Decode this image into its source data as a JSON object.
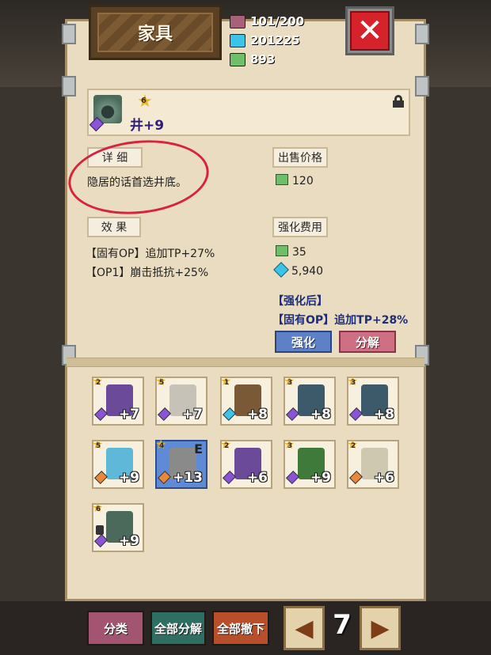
{
  "header": {
    "title": "家具",
    "resources": {
      "storage": "101/200",
      "crystal": "201225",
      "ore": "893"
    },
    "close_icon": "close-x-icon"
  },
  "item": {
    "name": "井+9",
    "star_level": "6",
    "locked": true
  },
  "detail": {
    "tab_label": "详 细",
    "description": "隐居的话首选井底。"
  },
  "sell": {
    "label": "出售价格",
    "value": "120"
  },
  "effect": {
    "label": "效 果",
    "lines": [
      "【固有OP】追加TP+27%",
      "【OP1】崩击抵抗+25%"
    ]
  },
  "upgrade": {
    "label": "强化费用",
    "ore_cost": "35",
    "crystal_cost": "5,940",
    "after_label": "【强化后】",
    "after_line": "【固有OP】追加TP+28%",
    "upgrade_button": "强化",
    "dismantle_button": "分解"
  },
  "inventory": [
    {
      "level": "2",
      "plus": "+7",
      "gem": "#8b53d6",
      "art": "grape-plant",
      "color": "#6b4a9a"
    },
    {
      "level": "5",
      "plus": "+7",
      "gem": "#8b53d6",
      "art": "bust-statue",
      "color": "#c7c2b8"
    },
    {
      "level": "1",
      "plus": "+8",
      "gem": "#3ac4e8",
      "art": "bookshelf",
      "color": "#7a5a36"
    },
    {
      "level": "3",
      "plus": "+8",
      "gem": "#8b53d6",
      "art": "stone-tower",
      "color": "#3d5a6a"
    },
    {
      "level": "3",
      "plus": "+8",
      "gem": "#8b53d6",
      "art": "stone-tower",
      "color": "#3d5a6a"
    },
    {
      "level": "5",
      "plus": "+9",
      "gem": "#e8883a",
      "art": "crystal-pillar",
      "color": "#5fb8d8"
    },
    {
      "level": "4",
      "plus": "+13",
      "gem": "#e8883a",
      "art": "gravestone",
      "color": "#8a8a8a",
      "badge": "E",
      "selected": true
    },
    {
      "level": "2",
      "plus": "+6",
      "gem": "#8b53d6",
      "art": "grape-plant",
      "color": "#6b4a9a"
    },
    {
      "level": "3",
      "plus": "+9",
      "gem": "#8b53d6",
      "art": "flower-plant",
      "color": "#3f7a3a"
    },
    {
      "level": "2",
      "plus": "+6",
      "gem": "#e8883a",
      "art": "skeleton-statue",
      "color": "#cfc8b0"
    },
    {
      "level": "6",
      "plus": "+9",
      "gem": "#8b53d6",
      "art": "well",
      "color": "#4b6a5c",
      "locked": true
    }
  ],
  "footer": {
    "sort_button": "分类",
    "dismantle_all_button": "全部分解",
    "remove_all_button": "全部撤下",
    "page": "7",
    "prev_icon": "triangle-left-icon",
    "next_icon": "triangle-right-icon"
  }
}
